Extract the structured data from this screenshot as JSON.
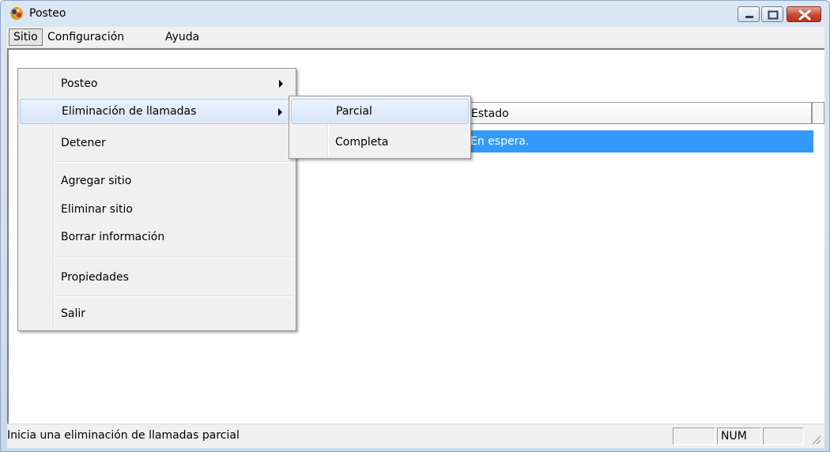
{
  "window": {
    "title": "Posteo",
    "icon": "app-icon",
    "buttons": [
      "minimize-icon",
      "maximize-icon",
      "close-icon"
    ]
  },
  "menubar": {
    "items": [
      "Sitio",
      "Configuración",
      "Ayuda"
    ],
    "active": "Sitio"
  },
  "sitio_menu": {
    "items": [
      {
        "label": "Posteo",
        "submenu": true
      },
      {
        "label": "Eliminación de llamadas",
        "submenu": true,
        "highlighted": true
      },
      {
        "label": "Detener"
      },
      {
        "separator": true
      },
      {
        "label": "Agregar sitio"
      },
      {
        "label": "Eliminar sitio"
      },
      {
        "label": "Borrar información"
      },
      {
        "separator": true
      },
      {
        "label": "Propiedades"
      },
      {
        "separator": true
      },
      {
        "label": "Salir"
      }
    ]
  },
  "submenu": {
    "items": [
      {
        "label": "Parcial",
        "highlighted": true
      },
      {
        "label": "Completa"
      }
    ]
  },
  "listview": {
    "columns": [
      "Estado"
    ],
    "rows": [
      {
        "estado": "En espera.",
        "selected": true
      }
    ]
  },
  "statusbar": {
    "text": "Inicia una eliminación de llamadas parcial",
    "indicators": [
      "",
      "NUM",
      ""
    ]
  },
  "colors": {
    "selection": "#3399ff",
    "menu_highlight": "#d8e6f8",
    "window_frame": "#c9d9ec"
  }
}
